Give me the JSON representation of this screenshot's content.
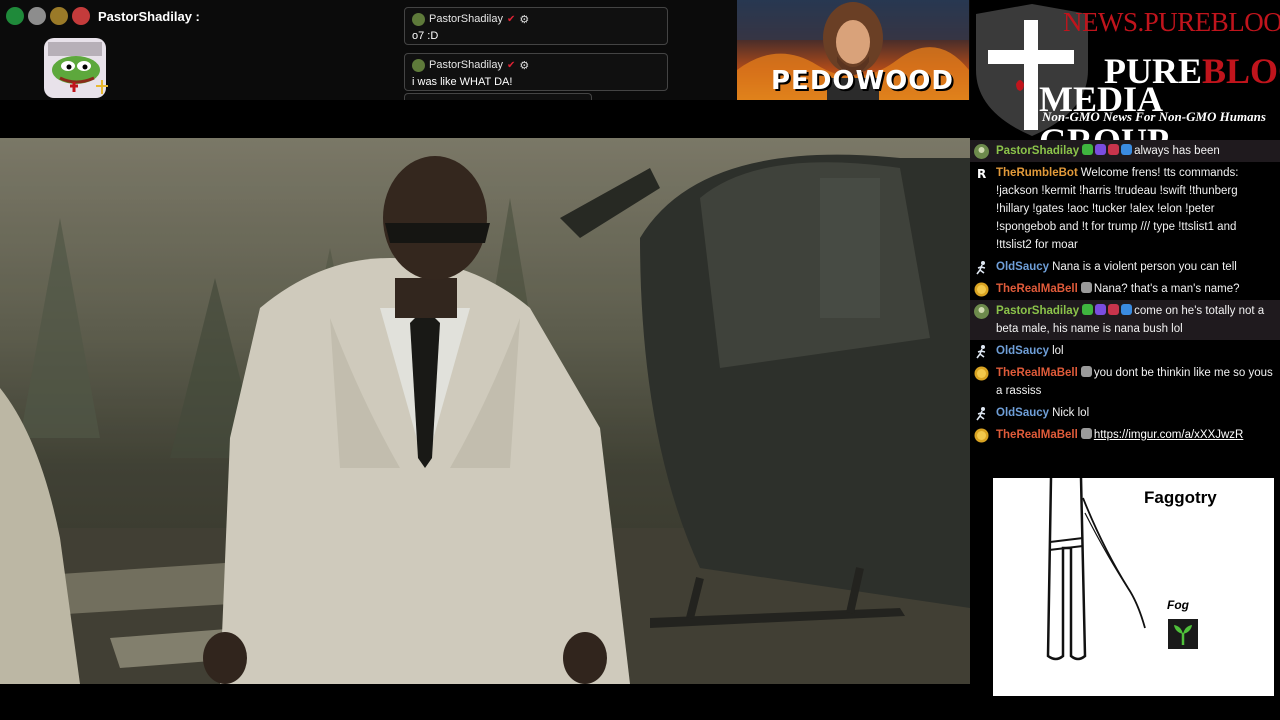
{
  "tts_bar": {
    "username": "PastorShadilay :",
    "badge_colors": [
      "#1f8a3a",
      "#8d8d8d",
      "#9a7a28",
      "#c43b3b"
    ]
  },
  "popups": [
    {
      "username": "PastorShadilay",
      "message": "o7 :D"
    },
    {
      "username": "PastorShadilay",
      "message": "i was like WHAT DA!"
    }
  ],
  "thumbnail": {
    "caption": "PEDOWOOD"
  },
  "logo": {
    "url": "NEWS.PUREBLOOD.MEDIA",
    "word1_a": "P",
    "word1_b": "URE",
    "word1_c": "BLOOD",
    "word2": "MEDIA GROUP",
    "tagline": "Non-GMO News For Non-GMO Humans"
  },
  "chat": {
    "messages": [
      {
        "user": "PastorShadilay",
        "user_color": "#8bc34a",
        "icon": "avatar-icon",
        "badges": [
          "#3fb53f",
          "#7a4de0",
          "#c8344c",
          "#3a8be0"
        ],
        "text": "always has been",
        "highlight": true
      },
      {
        "user": "TheRumbleBot",
        "user_color": "#e29a3a",
        "icon": "rumble-r-icon",
        "badges": [],
        "text": "Welcome frens! tts commands: !jackson !kermit !harris !trudeau !swift !thunberg !hillary !gates !aoc !tucker !alex !elon !peter !spongebob and !t for trump /// type !ttslist1 and !ttslist2 for moar",
        "highlight": false
      },
      {
        "user": "OldSaucy",
        "user_color": "#6f9fd8",
        "icon": "runner-icon",
        "badges": [],
        "text": "Nana is a violent person you can tell",
        "highlight": false
      },
      {
        "user": "TheRealMaBell",
        "user_color": "#e05b3a",
        "icon": "gold-coin-icon",
        "badges": [
          "#9a9a9a"
        ],
        "text": "Nana? that's a man's name?",
        "highlight": false
      },
      {
        "user": "PastorShadilay",
        "user_color": "#8bc34a",
        "icon": "avatar-icon",
        "badges": [
          "#3fb53f",
          "#7a4de0",
          "#c8344c",
          "#3a8be0"
        ],
        "text": "come on he's totally not a beta male, his name is nana bush lol",
        "highlight": true
      },
      {
        "user": "OldSaucy",
        "user_color": "#6f9fd8",
        "icon": "runner-icon",
        "badges": [],
        "text": "lol",
        "highlight": false
      },
      {
        "user": "TheRealMaBell",
        "user_color": "#e05b3a",
        "icon": "gold-coin-icon",
        "badges": [
          "#9a9a9a"
        ],
        "text": "you dont be thinkin like me so yous a rassiss",
        "highlight": false
      },
      {
        "user": "OldSaucy",
        "user_color": "#6f9fd8",
        "icon": "runner-icon",
        "badges": [],
        "text": "Nick lol",
        "highlight": false
      },
      {
        "user": "TheRealMaBell",
        "user_color": "#e05b3a",
        "icon": "gold-coin-icon",
        "badges": [
          "#9a9a9a"
        ],
        "text": "",
        "link": "https://imgur.com/a/xXXJwzR",
        "highlight": false
      }
    ]
  },
  "meme": {
    "title": "Faggotry",
    "label": "Fog"
  }
}
